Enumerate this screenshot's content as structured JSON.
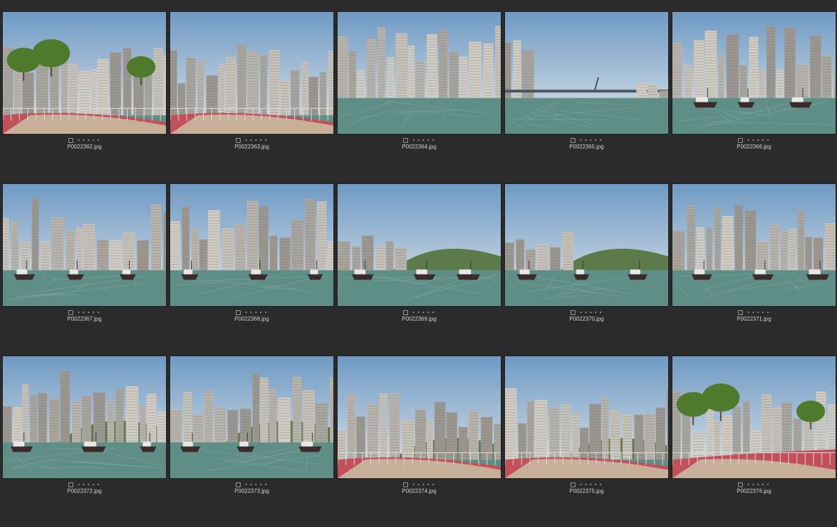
{
  "thumbnails": [
    {
      "filename": "P0022362.jpg",
      "scene": "walkway-left"
    },
    {
      "filename": "P0022363.jpg",
      "scene": "walkway-curve"
    },
    {
      "filename": "P0022364.jpg",
      "scene": "pier-towers"
    },
    {
      "filename": "P0022365.jpg",
      "scene": "bridge-haze"
    },
    {
      "filename": "P0022366.jpg",
      "scene": "tanker-towers"
    },
    {
      "filename": "P0022367.jpg",
      "scene": "towers-boats"
    },
    {
      "filename": "P0022368.jpg",
      "scene": "towers-boats-2"
    },
    {
      "filename": "P0022369.jpg",
      "scene": "hills-boats"
    },
    {
      "filename": "P0022370.jpg",
      "scene": "bridge-boats"
    },
    {
      "filename": "P0022371.jpg",
      "scene": "boats-city"
    },
    {
      "filename": "P0022372.jpg",
      "scene": "harbour-wide"
    },
    {
      "filename": "P0022373.jpg",
      "scene": "harbour-towers"
    },
    {
      "filename": "P0022374.jpg",
      "scene": "promenade-curve"
    },
    {
      "filename": "P0022375.jpg",
      "scene": "promenade-red"
    },
    {
      "filename": "P0022376.jpg",
      "scene": "promenade-trees"
    }
  ],
  "colors": {
    "background": "#2b2b2b",
    "sky": "#8fb4d6",
    "water": "#5f8e86",
    "path": "#c2505a"
  }
}
